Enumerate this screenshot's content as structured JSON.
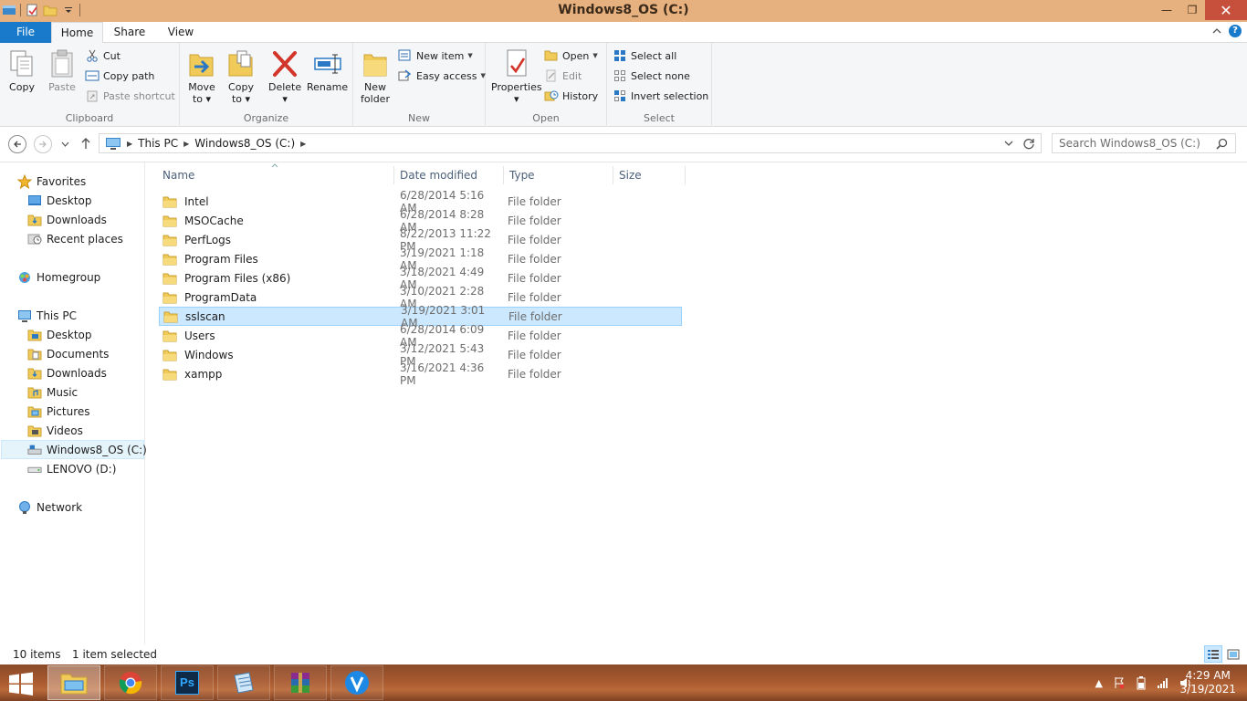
{
  "window": {
    "title": "Windows8_OS (C:)",
    "controls": {
      "minimize": "—",
      "maximize": "❐",
      "close": "✕"
    }
  },
  "ribbon_tabs": [
    {
      "label": "File"
    },
    {
      "label": "Home"
    },
    {
      "label": "Share"
    },
    {
      "label": "View"
    }
  ],
  "ribbon": {
    "clipboard": {
      "label": "Clipboard",
      "copy": "Copy",
      "paste": "Paste",
      "cut": "Cut",
      "copy_path": "Copy path",
      "paste_shortcut": "Paste shortcut"
    },
    "organize": {
      "label": "Organize",
      "move_to": [
        "Move",
        "to ▾"
      ],
      "copy_to": [
        "Copy",
        "to ▾"
      ],
      "delete": [
        "Delete",
        "▾"
      ],
      "rename": "Rename"
    },
    "new": {
      "label": "New",
      "new_folder": [
        "New",
        "folder"
      ],
      "new_item": "New item",
      "easy_access": "Easy access"
    },
    "open": {
      "label": "Open",
      "properties": [
        "Properties",
        "▾"
      ],
      "open": "Open",
      "edit": "Edit",
      "history": "History"
    },
    "select": {
      "label": "Select",
      "select_all": "Select all",
      "select_none": "Select none",
      "invert_selection": "Invert selection"
    }
  },
  "address": {
    "crumbs": [
      "This PC",
      "Windows8_OS (C:)"
    ],
    "search_placeholder": "Search Windows8_OS (C:)"
  },
  "nav_pane": {
    "favorites": {
      "label": "Favorites",
      "items": [
        "Desktop",
        "Downloads",
        "Recent places"
      ]
    },
    "homegroup": "Homegroup",
    "this_pc": {
      "label": "This PC",
      "items": [
        "Desktop",
        "Documents",
        "Downloads",
        "Music",
        "Pictures",
        "Videos",
        "Windows8_OS (C:)",
        "LENOVO (D:)"
      ]
    },
    "network": "Network"
  },
  "columns": [
    "Name",
    "Date modified",
    "Type",
    "Size"
  ],
  "files": [
    {
      "name": "Intel",
      "date": "6/28/2014 5:16 AM",
      "type": "File folder"
    },
    {
      "name": "MSOCache",
      "date": "6/28/2014 8:28 AM",
      "type": "File folder"
    },
    {
      "name": "PerfLogs",
      "date": "8/22/2013 11:22 PM",
      "type": "File folder"
    },
    {
      "name": "Program Files",
      "date": "3/19/2021 1:18 AM",
      "type": "File folder"
    },
    {
      "name": "Program Files (x86)",
      "date": "3/18/2021 4:49 AM",
      "type": "File folder"
    },
    {
      "name": "ProgramData",
      "date": "3/10/2021 2:28 AM",
      "type": "File folder"
    },
    {
      "name": "sslscan",
      "date": "3/19/2021 3:01 AM",
      "type": "File folder"
    },
    {
      "name": "Users",
      "date": "6/28/2014 6:09 AM",
      "type": "File folder"
    },
    {
      "name": "Windows",
      "date": "3/12/2021 5:43 PM",
      "type": "File folder"
    },
    {
      "name": "xampp",
      "date": "3/16/2021 4:36 PM",
      "type": "File folder"
    }
  ],
  "status": {
    "item_count": "10 items",
    "selected": "1 item selected"
  },
  "taskbar": {
    "apps": [
      "file-explorer",
      "chrome",
      "photoshop",
      "notepad",
      "winrar",
      "vpn-client"
    ],
    "ps_label": "Ps",
    "clock_time": "4:29 AM",
    "clock_date": "3/19/2021"
  }
}
